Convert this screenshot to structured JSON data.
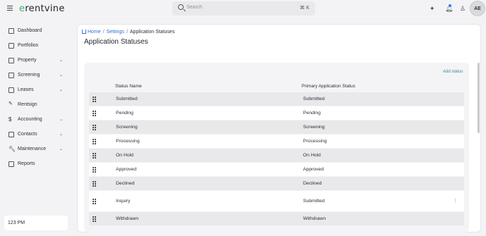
{
  "app": {
    "logo_text": "rentvine",
    "logo_letter": "e"
  },
  "search": {
    "placeholder": "Search",
    "shortcut": "⌘ K"
  },
  "user": {
    "initials": "AE"
  },
  "sidebar": {
    "items": [
      {
        "label": "Dashboard",
        "icon": "grid-icon",
        "has_chevron": false
      },
      {
        "label": "Portfolios",
        "icon": "folder-icon",
        "has_chevron": false
      },
      {
        "label": "Property",
        "icon": "building-icon",
        "has_chevron": true
      },
      {
        "label": "Screening",
        "icon": "document-icon",
        "has_chevron": true
      },
      {
        "label": "Leases",
        "icon": "clipboard-icon",
        "has_chevron": true
      },
      {
        "label": "Rentsign",
        "icon": "signature-icon",
        "has_chevron": false
      },
      {
        "label": "Accounting",
        "icon": "dollar-icon",
        "has_chevron": true
      },
      {
        "label": "Contacts",
        "icon": "contacts-icon",
        "has_chevron": true
      },
      {
        "label": "Maintenance",
        "icon": "wrench-icon",
        "has_chevron": true
      },
      {
        "label": "Reports",
        "icon": "chart-icon",
        "has_chevron": false
      }
    ],
    "clock": "123 PM"
  },
  "breadcrumb": {
    "home": "Home",
    "settings": "Settings",
    "current": "Application Statuses"
  },
  "page": {
    "title": "Application Statuses",
    "add_status": "Add status"
  },
  "table": {
    "headers": {
      "status_name": "Status Name",
      "primary_status": "Primary Application Status"
    },
    "rows": [
      {
        "name": "Submitted",
        "primary": "Submitted"
      },
      {
        "name": "Pending",
        "primary": "Pending"
      },
      {
        "name": "Screening",
        "primary": "Screening"
      },
      {
        "name": "Processing",
        "primary": "Processing"
      },
      {
        "name": "On Hold",
        "primary": "On Hold"
      },
      {
        "name": "Approved",
        "primary": "Approved"
      },
      {
        "name": "Declined",
        "primary": "Declined"
      },
      {
        "name": "Inquiry",
        "primary": "Submitted"
      },
      {
        "name": "Withdrawn",
        "primary": "Withdrawn"
      }
    ]
  },
  "colors": {
    "accent": "#2f6fd6",
    "logo_accent": "#3bb36a",
    "link_teal": "#2f8f9f"
  }
}
